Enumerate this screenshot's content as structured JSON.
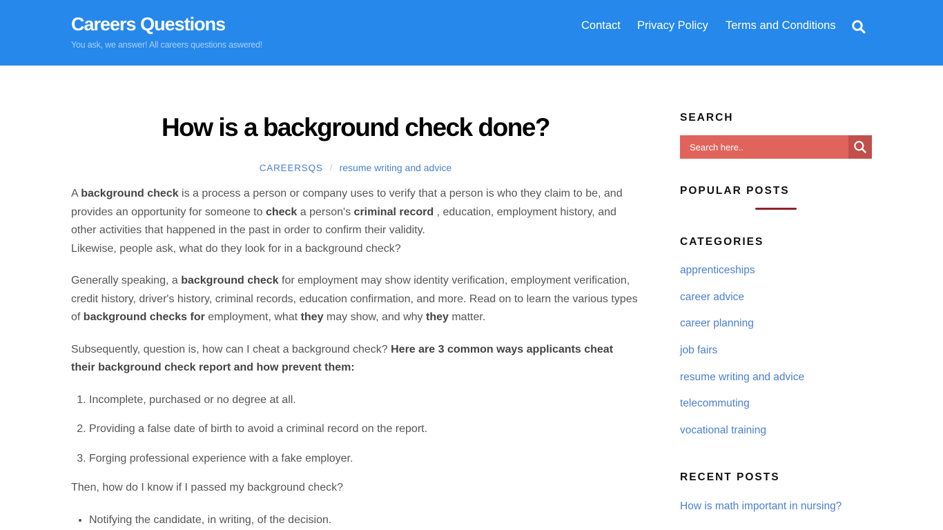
{
  "header": {
    "site_title": "Careers Questions",
    "tagline": "You ask, we answer! All careers questions aswered!",
    "nav": [
      {
        "label": "Contact"
      },
      {
        "label": "Privacy Policy"
      },
      {
        "label": "Terms and Conditions"
      }
    ],
    "search_icon": "search-icon",
    "colors": {
      "background": "#2588ea",
      "text": "#ffffff"
    }
  },
  "post": {
    "title": "How is a background check done?",
    "author": "CAREERSQS",
    "separator": "/",
    "category": "resume writing and advice",
    "p1": {
      "t1": "A ",
      "b1": "background check",
      "t2": " is a process a person or company uses to verify that a person is who they claim to be, and provides an opportunity for someone to ",
      "b2": "check",
      "t3": " a person's ",
      "b3": "criminal record",
      "t4": " , education, employment history, and other activities that happened in the past in order to confirm their validity.",
      "t5": "Likewise, people ask, what do they look for in a background check?"
    },
    "p2": {
      "t1": "Generally speaking, a ",
      "b1": "background check",
      "t2": " for employment may show identity verification, employment verification, credit history, driver's history, criminal records, education confirmation, and more. Read on to learn the various types of ",
      "b2": "background checks for",
      "t3": " employment, what ",
      "b3": "they",
      "t4": " may show, and why ",
      "b4": "they",
      "t5": " matter."
    },
    "p3": {
      "t1": "Subsequently, question is, how can I cheat a background check? ",
      "b1": "Here are 3 common ways applicants cheat their background check report and how prevent them:"
    },
    "ordered_list": [
      "Incomplete, purchased or no degree at all.",
      "Providing a false date of birth to avoid a criminal record on the report.",
      "Forging professional experience with a fake employer."
    ],
    "p4": "Then, how do I know if I passed my background check?",
    "bullet_list": [
      "Notifying the candidate, in writing, of the decision."
    ]
  },
  "sidebar": {
    "search": {
      "title": "SEARCH",
      "placeholder": "Search here..",
      "button_icon": "search-icon",
      "colors": {
        "field": "#e0645c",
        "button": "#c14f4a"
      }
    },
    "popular_posts": {
      "title": "POPULAR POSTS",
      "underline_color": "#8e2429"
    },
    "categories": {
      "title": "CATEGORIES",
      "items": [
        "apprenticeships",
        "career advice",
        "career planning",
        "job fairs",
        "resume writing and advice",
        "telecommuting",
        "vocational training"
      ]
    },
    "recent_posts": {
      "title": "RECENT POSTS",
      "items": [
        "How is math important in nursing?"
      ]
    }
  },
  "colors": {
    "link": "#4a7fd0",
    "body_text": "#555555",
    "heading": "#000000"
  }
}
